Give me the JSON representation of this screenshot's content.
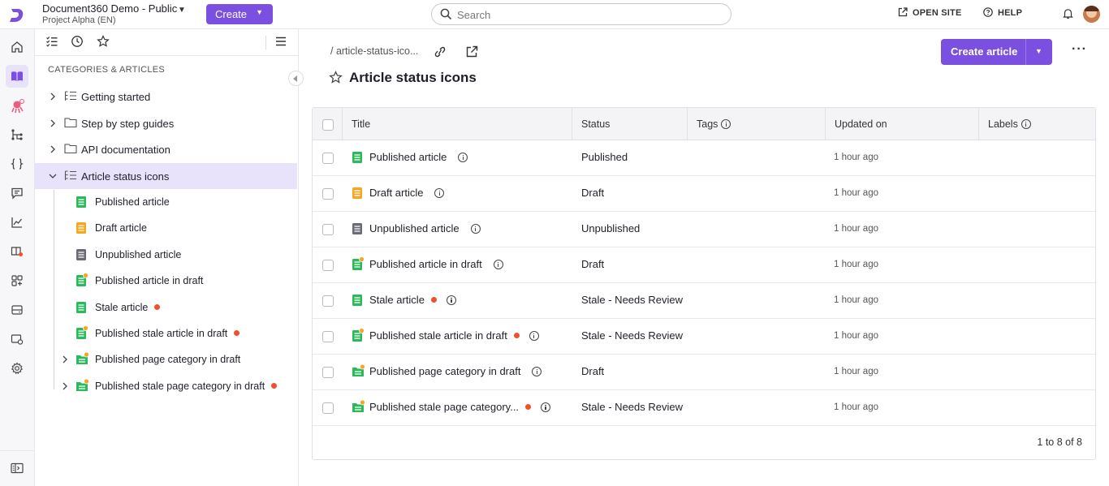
{
  "topbar": {
    "project_name": "Document360 Demo - Public",
    "project_version": "Project Alpha (EN)",
    "create_label": "Create",
    "search_placeholder": "Search",
    "open_site_label": "OPEN SITE",
    "help_label": "HELP"
  },
  "rail": {
    "items": [
      "home-icon",
      "documentation-icon",
      "ai-assistant-icon",
      "workflow-icon",
      "api-icon",
      "feedback-icon",
      "analytics-icon",
      "widget-icon",
      "integrations-icon",
      "drive-icon",
      "knowledge-base-settings-icon",
      "settings-icon"
    ],
    "footer_item": "collapse-sidebar-icon"
  },
  "panel": {
    "heading": "CATEGORIES & ARTICLES",
    "categories": [
      {
        "label": "Getting started"
      },
      {
        "label": "Step by step guides"
      },
      {
        "label": "API documentation"
      },
      {
        "label": "Article status icons"
      }
    ],
    "children": [
      {
        "label": "Published article",
        "color": "#2eb85c",
        "stale": false,
        "draft_dot": false
      },
      {
        "label": "Draft article",
        "color": "#f5a623",
        "stale": false,
        "draft_dot": false
      },
      {
        "label": "Unpublished article",
        "color": "#6b6b75",
        "stale": false,
        "draft_dot": false
      },
      {
        "label": "Published article in draft",
        "color": "#2eb85c",
        "stale": false,
        "draft_dot": true
      },
      {
        "label": "Stale article",
        "color": "#2eb85c",
        "stale": true,
        "draft_dot": false
      },
      {
        "label": "Published stale article in draft",
        "color": "#2eb85c",
        "stale": true,
        "draft_dot": true
      },
      {
        "label": "Published page category in draft",
        "color": "#2eb85c",
        "stale": false,
        "draft_dot": true
      },
      {
        "label": "Published stale page category in draft",
        "color": "#2eb85c",
        "stale": true,
        "draft_dot": true
      }
    ]
  },
  "main": {
    "breadcrumb": "/ article-status-ico...",
    "title": "Article status icons",
    "create_article_label": "Create article",
    "more_label": "···",
    "columns": {
      "title": "Title",
      "status": "Status",
      "tags": "Tags",
      "updated_on": "Updated on",
      "labels": "Labels"
    },
    "rows": [
      {
        "title": "Published article",
        "status": "Published",
        "updated": "1 hour ago"
      },
      {
        "title": "Draft article",
        "status": "Draft",
        "updated": "1 hour ago"
      },
      {
        "title": "Unpublished article",
        "status": "Unpublished",
        "updated": "1 hour ago"
      },
      {
        "title": "Published article in draft",
        "status": "Draft",
        "updated": "1 hour ago"
      },
      {
        "title": "Stale article",
        "status": "Stale - Needs Review",
        "updated": "1 hour ago"
      },
      {
        "title": "Published stale article in draft",
        "status": "Stale - Needs Review",
        "updated": "1 hour ago"
      },
      {
        "title": "Published page category in draft",
        "status": "Draft",
        "updated": "1 hour ago"
      },
      {
        "title": "Published stale page category...",
        "status": "Stale - Needs Review",
        "updated": "1 hour ago"
      }
    ],
    "pagination": "1 to 8 of 8"
  },
  "colors": {
    "accent": "#7b4fe0",
    "published": "#2eb85c",
    "draft": "#f5a623",
    "unpublished": "#6b6b75",
    "stale_dot": "#f0502a"
  }
}
